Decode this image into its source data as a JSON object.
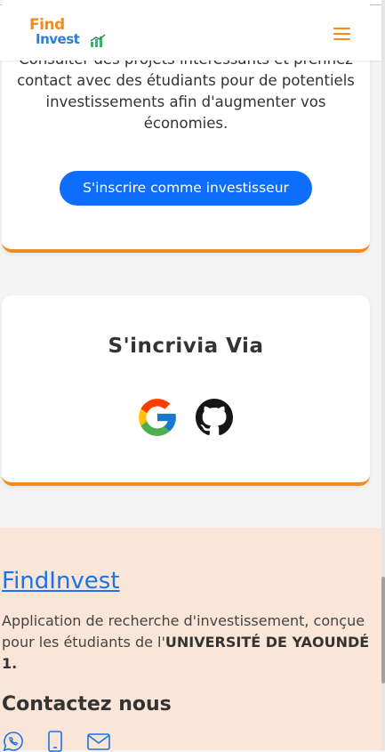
{
  "brand": {
    "logo_top": "Find",
    "logo_bottom": "Invest"
  },
  "invest_card": {
    "description": "Consulter des projets intéressants et prennez contact avec des étudiants pour de potentiels investissements afin d'augmenter vos économies.",
    "cta_label": "S'inscrire comme investisseur"
  },
  "signup_card": {
    "heading": "S'incrivia Via",
    "providers": [
      {
        "name": "google-icon"
      },
      {
        "name": "github-icon"
      }
    ]
  },
  "footer": {
    "brand_link": "FindInvest",
    "about_text": "Application de recherche d'investissement, conçue pour les étudiants de l'",
    "about_university": "UNIVERSITÉ DE YAOUNDÉ 1.",
    "contact_title": "Contactez nous",
    "contact_icons": [
      "whatsapp-icon",
      "phone-icon",
      "email-icon"
    ]
  },
  "colors": {
    "accent_orange": "#f28b1c",
    "primary_blue": "#0d6efd",
    "link_blue": "#1a73e8",
    "footer_bg": "#fae6d8"
  }
}
